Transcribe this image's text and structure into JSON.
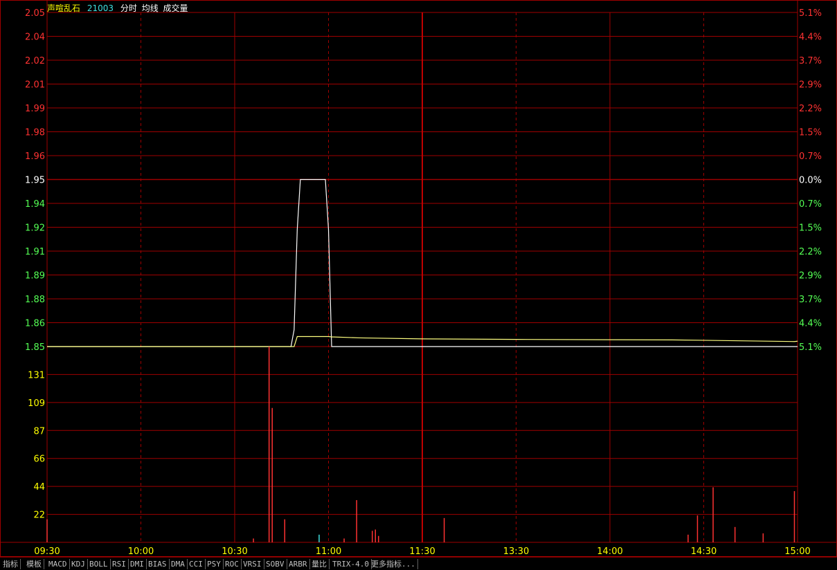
{
  "header": {
    "stock_name": "声喧乱石",
    "code": "21003",
    "label_minute": "分时",
    "label_avg": "均线",
    "label_volume": "成交量"
  },
  "colors": {
    "up": "#ff3232",
    "down": "#54ff54",
    "grid": "#a00000",
    "price_line": "#ffffff",
    "avg_line": "#ffff80",
    "volume_label": "#ffff00",
    "time_label": "#ffff00",
    "header_name": "#ffff00",
    "header_code": "#40e0e0"
  },
  "chart_data": [
    {
      "type": "line",
      "price_ticks_left": [
        "2.05",
        "2.04",
        "2.02",
        "2.01",
        "1.99",
        "1.98",
        "1.96",
        "1.95",
        "1.94",
        "1.92",
        "1.91",
        "1.89",
        "1.88",
        "1.86",
        "1.85"
      ],
      "percent_ticks_right": [
        "5.1%",
        "4.4%",
        "3.7%",
        "2.9%",
        "2.2%",
        "1.5%",
        "0.7%",
        "0.0%",
        "0.7%",
        "1.5%",
        "2.2%",
        "2.9%",
        "3.7%",
        "4.4%",
        "5.1%"
      ],
      "prev_close": 1.95,
      "ylim": [
        1.85,
        2.05
      ],
      "x_ticks": [
        "09:30",
        "10:00",
        "10:30",
        "11:00",
        "11:30",
        "13:30",
        "14:00",
        "14:30",
        "15:00"
      ],
      "series": [
        {
          "name": "分时",
          "x": [
            0,
            78,
            79,
            80,
            81,
            89,
            90,
            91,
            240
          ],
          "values": [
            1.85,
            1.85,
            1.86,
            1.92,
            1.95,
            1.95,
            1.92,
            1.85,
            1.85
          ]
        },
        {
          "name": "均线",
          "x": [
            0,
            79,
            80,
            90,
            91,
            100,
            120,
            150,
            180,
            200,
            220,
            239,
            240
          ],
          "values": [
            1.85,
            1.85,
            1.856,
            1.856,
            1.8558,
            1.8552,
            1.8546,
            1.8543,
            1.8541,
            1.854,
            1.8535,
            1.853,
            1.8532
          ]
        }
      ]
    },
    {
      "type": "bar",
      "volume_ticks": [
        "131",
        "109",
        "87",
        "66",
        "44",
        "22"
      ],
      "ylim": [
        0,
        153
      ],
      "x": [
        0,
        66,
        71,
        72,
        76,
        87,
        95,
        99,
        104,
        105,
        106,
        127,
        205,
        208,
        213,
        220,
        229,
        239
      ],
      "values": [
        18,
        3,
        153,
        105,
        18,
        6,
        3,
        33,
        9,
        10,
        5,
        19,
        6,
        21,
        43,
        12,
        7,
        40
      ],
      "colors": [
        "up",
        "up",
        "up",
        "up",
        "up",
        "down",
        "up",
        "up",
        "up",
        "up",
        "up",
        "up",
        "up",
        "up",
        "up",
        "up",
        "up",
        "up"
      ]
    }
  ],
  "tabs": [
    "指标",
    "模板",
    "MACD",
    "KDJ",
    "BOLL",
    "RSI",
    "DMI",
    "BIAS",
    "DMA",
    "CCI",
    "PSY",
    "ROC",
    "VRSI",
    "SOBV",
    "ARBR",
    "量比",
    "TRIX-4.0",
    "更多指标..."
  ]
}
